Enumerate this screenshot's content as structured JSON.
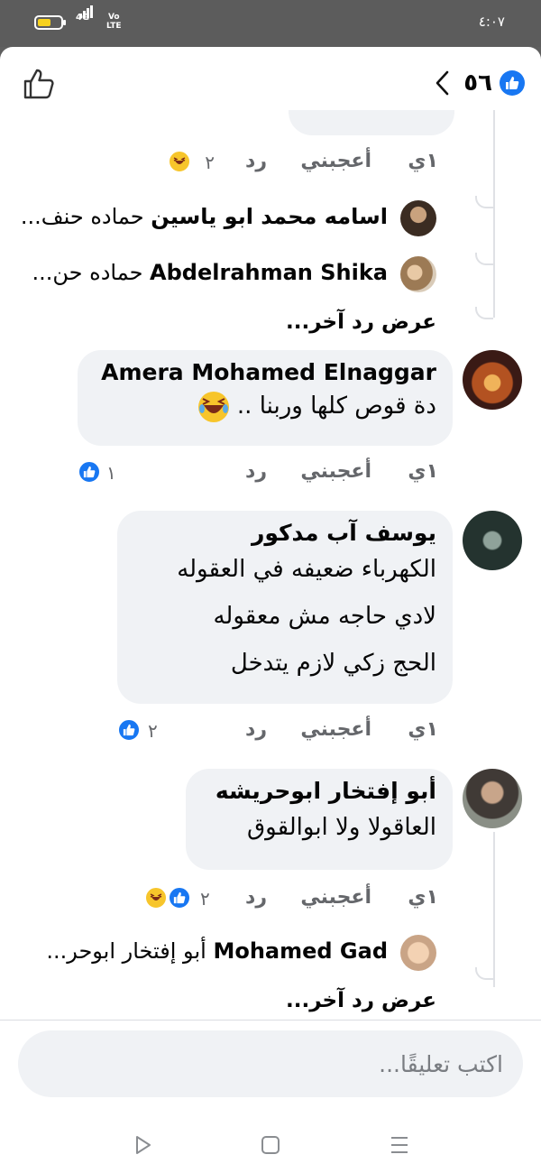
{
  "status_bar": {
    "network": "4G",
    "volte": "Vo\nLTE",
    "clock": "٤:٠٧"
  },
  "header": {
    "reaction_count": "٥٦",
    "like_icon": "thumbs-up-outline-icon",
    "back_icon": "chevron-left-icon"
  },
  "comments": [
    {
      "actions": {
        "time": "١ي",
        "like": "أعجبني",
        "reply": "رد",
        "reaction_count": "٢"
      },
      "replies": [
        {
          "name": "اسامه محمد ابو ياسين",
          "text": "حماده حنف..."
        },
        {
          "name": "Abdelrahman Shika",
          "text": "حماده حن..."
        }
      ],
      "more_replies": "عرض رد آخر..."
    },
    {
      "name": "Amera Mohamed Elnaggar",
      "text": "دة قوص كلها وربنا ..",
      "actions": {
        "time": "١ي",
        "like": "أعجبني",
        "reply": "رد",
        "reaction_count": "١"
      }
    },
    {
      "name": "يوسف آب مدكور",
      "lines": [
        "الكهرباء ضعيفه في العقوله",
        "لادي حاجه مش معقوله",
        "الحج زكي لازم يتدخل"
      ],
      "actions": {
        "time": "١ي",
        "like": "أعجبني",
        "reply": "رد",
        "reaction_count": "٢"
      }
    },
    {
      "name": "أبو إفتخار ابوحريشه",
      "text": "العاقولا ولا ابوالقوق",
      "actions": {
        "time": "١ي",
        "like": "أعجبني",
        "reply": "رد",
        "reaction_count": "٢"
      },
      "replies": [
        {
          "name": "Mohamed Gad",
          "text": "أبو إفتخار ابوحر..."
        }
      ],
      "more_replies": "عرض رد آخر..."
    }
  ],
  "composer": {
    "placeholder": "اكتب تعليقًا..."
  },
  "colors": {
    "accent": "#1877f2",
    "bubble": "#f0f2f5",
    "muted": "#65676b",
    "status_bar": "#5c5c5c"
  }
}
